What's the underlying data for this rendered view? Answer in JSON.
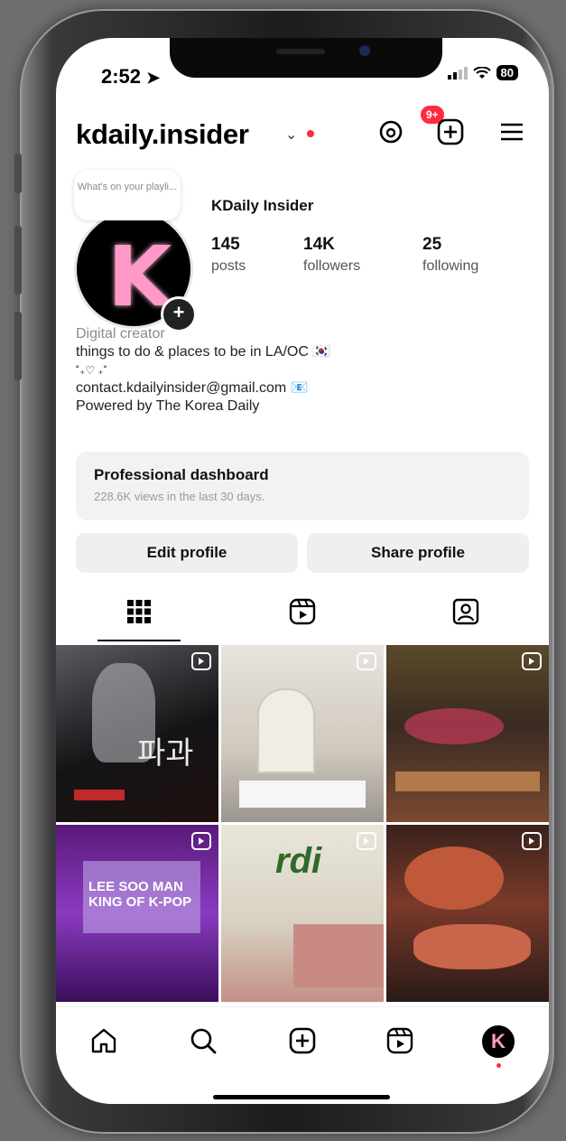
{
  "status_bar": {
    "time": "2:52",
    "battery": "80"
  },
  "header": {
    "username": "kdaily.insider",
    "threads_badge": "9+"
  },
  "profile": {
    "note": "What's on your playli...",
    "display_name": "KDaily Insider",
    "avatar_letter": "K",
    "stats": [
      {
        "value": "145",
        "label": "posts"
      },
      {
        "value": "14K",
        "label": "followers"
      },
      {
        "value": "25",
        "label": "following"
      }
    ],
    "category": "Digital creator",
    "bio_lines": [
      "things to do & places to be in LA/OC 🇰🇷",
      "˚₊♡ ₊˚",
      "contact.kdailyinsider@gmail.com 📧",
      "Powered by The Korea Daily"
    ]
  },
  "dashboard": {
    "title": "Professional dashboard",
    "subtitle": "228.6K views in the last 30 days."
  },
  "actions": {
    "edit_profile": "Edit profile",
    "share_profile": "Share profile"
  },
  "grid_posts": [
    {
      "overlay_text": "파과",
      "colors": [
        "#1b1b1e",
        "#4a4a4f"
      ]
    },
    {
      "overlay_text": "",
      "colors": [
        "#d9d2c8",
        "#b9b2a8"
      ]
    },
    {
      "overlay_text": "",
      "colors": [
        "#3e2a22",
        "#8a5a3a"
      ]
    },
    {
      "overlay_text": "LEE SOO MAN KING OF K-POP",
      "colors": [
        "#7a2aa8",
        "#3a0f5a"
      ]
    },
    {
      "overlay_text": "",
      "colors": [
        "#e6e2d6",
        "#c48f86"
      ]
    },
    {
      "overlay_text": "",
      "colors": [
        "#4a2a22",
        "#b0523a"
      ]
    }
  ],
  "colors": {
    "notification_red": "#ff2a3e",
    "avatar_pink": "#ff9ac8",
    "dashboard_bg": "#f2f2f4"
  },
  "icons": {
    "header": [
      "threads-icon",
      "new-post-icon",
      "menu-icon"
    ],
    "tabs": [
      "grid-icon",
      "reels-icon",
      "tagged-icon"
    ],
    "nav": [
      "home-icon",
      "search-icon",
      "create-icon",
      "reels-icon",
      "profile-avatar"
    ]
  }
}
